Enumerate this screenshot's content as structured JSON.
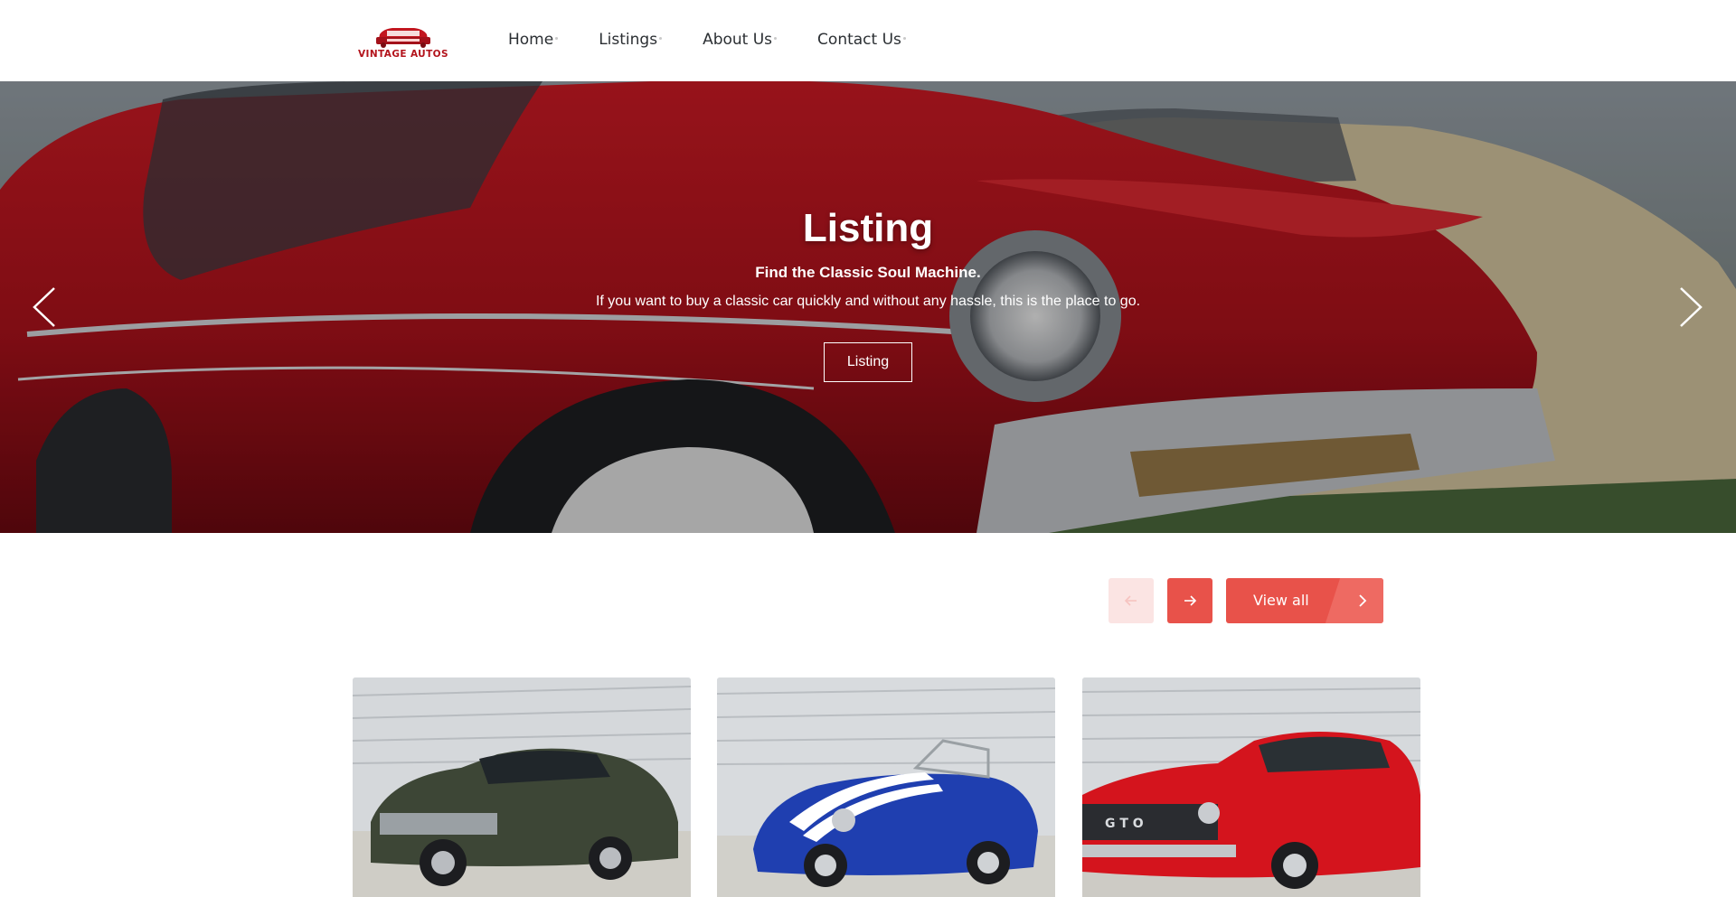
{
  "header": {
    "logo": {
      "text": "VINTAGE AUTOS",
      "icon": "classic-car-logo-icon",
      "color": "#b3141c"
    },
    "nav": [
      {
        "label": "Home"
      },
      {
        "label": "Listings"
      },
      {
        "label": "About Us"
      },
      {
        "label": "Contact Us"
      }
    ]
  },
  "hero": {
    "title": "Listing",
    "subtitle": "Find the Classic Soul Machine.",
    "description": "If you want to buy a classic car quickly and without any hassle, this is the place to go.",
    "button_label": "Listing",
    "prev_icon": "chevron-left-icon",
    "next_icon": "chevron-right-icon"
  },
  "listing_controls": {
    "prev_icon": "arrow-left-icon",
    "next_icon": "arrow-right-icon",
    "view_all_label": "View all",
    "view_all_icon": "chevron-right-icon",
    "accent_color": "#e8524a"
  },
  "cards": [
    {
      "image": "dark-green-muscle-car-photo",
      "car_color": "#3d4636"
    },
    {
      "image": "blue-roadster-white-stripes-photo",
      "car_color": "#1f3fb0"
    },
    {
      "image": "red-gto-coupe-photo",
      "car_color": "#d4141d"
    }
  ]
}
